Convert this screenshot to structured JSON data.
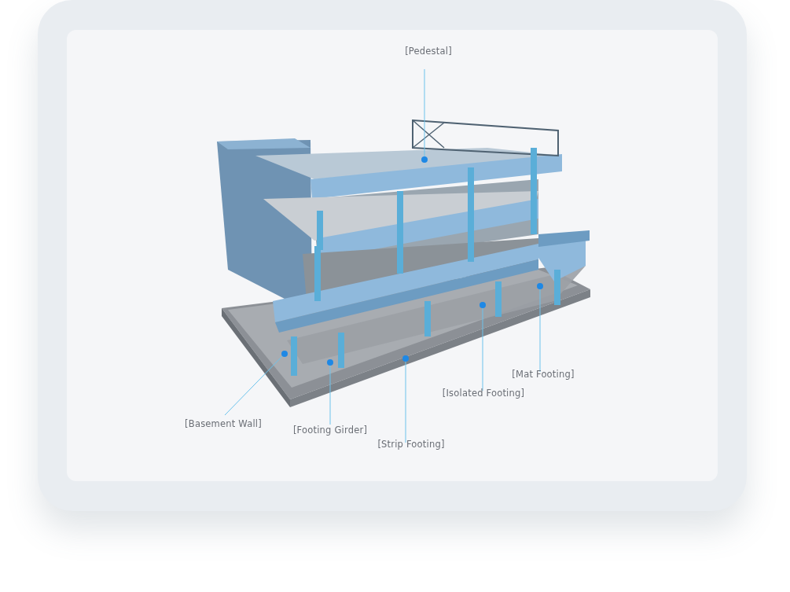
{
  "labels": [
    {
      "text": "[Pedestal]"
    },
    {
      "text": "[Basement Wall]"
    },
    {
      "text": "[Footing Girder]"
    },
    {
      "text": "[Strip Footing]"
    },
    {
      "text": "[Isolated Footing]"
    },
    {
      "text": "[Mat Footing]"
    }
  ]
}
